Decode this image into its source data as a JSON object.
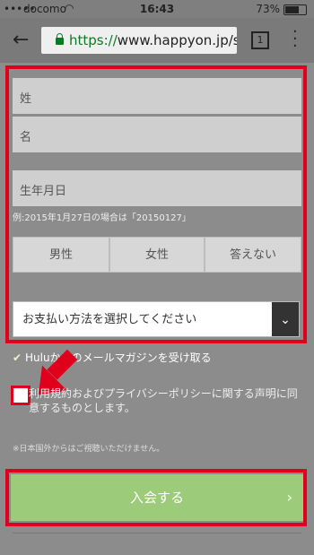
{
  "status_bar": {
    "carrier": "docomo",
    "time": "16:43",
    "battery": "73%"
  },
  "browser": {
    "url_scheme": "https://",
    "url_rest": "www.happyon.jp/s",
    "tabs_count": "1"
  },
  "form": {
    "last_name_placeholder": "姓",
    "first_name_placeholder": "名",
    "birthdate_placeholder": "生年月日",
    "birthdate_hint": "例:2015年1月27日の場合は「20150127」",
    "gender_options": [
      "男性",
      "女性",
      "答えない"
    ],
    "payment_select_placeholder": "お支払い方法を選択してください"
  },
  "newsletter": {
    "label": "Huluからのメールマガジンを受け取る"
  },
  "terms": {
    "label": "利用規約およびプライバシーポリシーに関する声明に同意するものとします。",
    "note": "※日本国外からはご視聴いただけません。"
  },
  "submit": {
    "label": "入会する"
  }
}
